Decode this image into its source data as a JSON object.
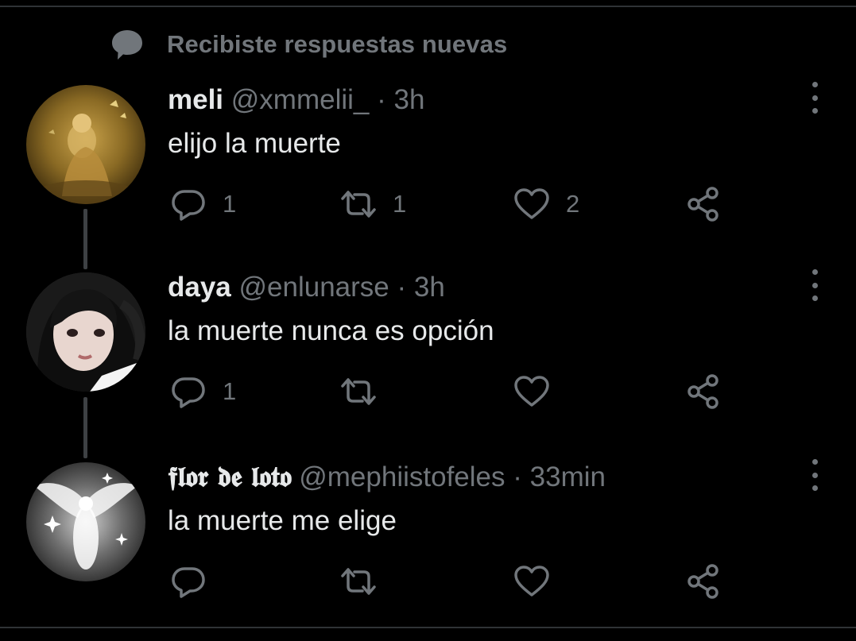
{
  "banner": {
    "icon": "chat-bubble-icon",
    "text": "Recibiste respuestas nuevas"
  },
  "tweets": [
    {
      "name": "meli",
      "handle": "@xmmelii_",
      "separator": "·",
      "time": "3h",
      "text": "elijo la muerte",
      "replies": "1",
      "retweets": "1",
      "likes": "2"
    },
    {
      "name": "daya",
      "handle": "@enlunarse",
      "separator": "·",
      "time": "3h",
      "text": "la muerte nunca es opción",
      "replies": "1",
      "retweets": "",
      "likes": ""
    },
    {
      "name": "𝖋𝖑𝖔𝖗 𝖉𝖊 𝖑𝖔𝖙𝖔",
      "handle": "@mephiistofeles",
      "separator": "·",
      "time": "33min",
      "text": "la muerte me elige",
      "replies": "",
      "retweets": "",
      "likes": ""
    }
  ],
  "colors": {
    "background": "#000000",
    "text_primary": "#e7e9ea",
    "text_secondary": "#71767b",
    "divider": "#2f3336",
    "thread_line": "#3e4144"
  },
  "icons": {
    "reply": "reply-icon",
    "retweet": "retweet-icon",
    "like": "heart-icon",
    "share": "share-icon",
    "more": "more-options-icon"
  }
}
